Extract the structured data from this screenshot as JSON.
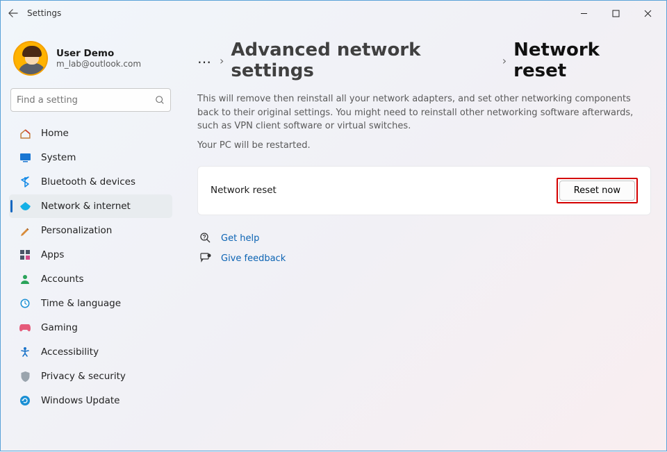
{
  "window": {
    "title": "Settings"
  },
  "user": {
    "name": "User Demo",
    "email": "m_lab@outlook.com"
  },
  "search": {
    "placeholder": "Find a setting"
  },
  "nav": {
    "home": "Home",
    "system": "System",
    "bluetooth": "Bluetooth & devices",
    "network": "Network & internet",
    "personalization": "Personalization",
    "apps": "Apps",
    "accounts": "Accounts",
    "time": "Time & language",
    "gaming": "Gaming",
    "accessibility": "Accessibility",
    "privacy": "Privacy & security",
    "update": "Windows Update"
  },
  "breadcrumb": {
    "ellipsis": "…",
    "advanced": "Advanced network settings",
    "current": "Network reset"
  },
  "content": {
    "description": "This will remove then reinstall all your network adapters, and set other networking components back to their original settings. You might need to reinstall other networking software afterwards, such as VPN client software or virtual switches.",
    "restart_note": "Your PC will be restarted.",
    "card_label": "Network reset",
    "reset_button": "Reset now"
  },
  "links": {
    "help": "Get help",
    "feedback": "Give feedback"
  }
}
